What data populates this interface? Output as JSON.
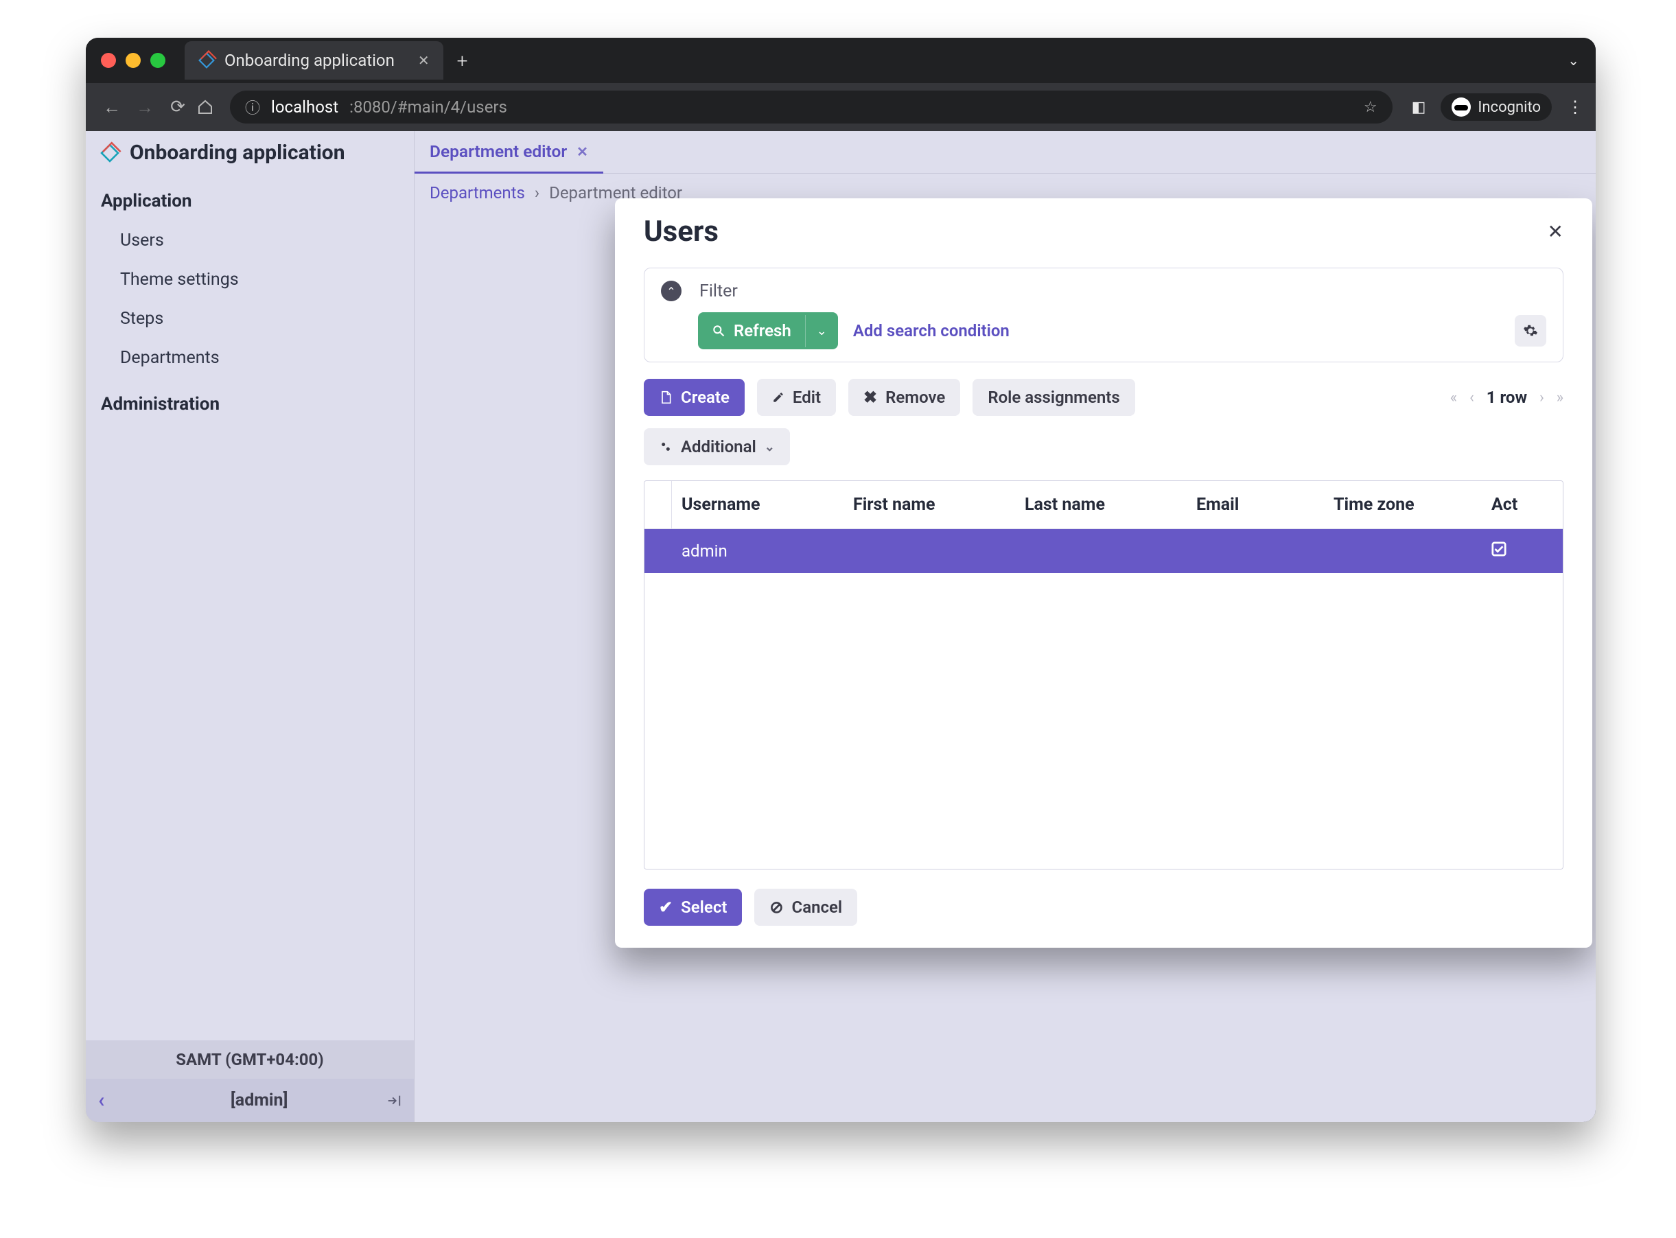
{
  "browser": {
    "tab_title": "Onboarding application",
    "url_host": "localhost",
    "url_port_path": ":8080/#main/4/users",
    "incognito_label": "Incognito"
  },
  "brand": {
    "title": "Onboarding application"
  },
  "sidebar": {
    "sections": [
      {
        "title": "Application",
        "items": [
          "Users",
          "Theme settings",
          "Steps",
          "Departments"
        ]
      },
      {
        "title": "Administration",
        "items": []
      }
    ],
    "timezone": "SAMT (GMT+04:00)",
    "user": "[admin]"
  },
  "tabs": [
    {
      "label": "Department editor"
    }
  ],
  "breadcrumbs": {
    "a": "Departments",
    "b": "Department editor"
  },
  "modal": {
    "title": "Users",
    "filter_label": "Filter",
    "refresh_label": "Refresh",
    "add_condition_label": "Add search condition",
    "toolbar": {
      "create": "Create",
      "edit": "Edit",
      "remove": "Remove",
      "roles": "Role assignments",
      "additional": "Additional"
    },
    "pager": {
      "count_label": "1 row"
    },
    "table": {
      "columns": [
        "Username",
        "First name",
        "Last name",
        "Email",
        "Time zone",
        "Act"
      ],
      "rows": [
        {
          "username": "admin",
          "first_name": "",
          "last_name": "",
          "email": "",
          "time_zone": "",
          "active": true
        }
      ]
    },
    "footer": {
      "select": "Select",
      "cancel": "Cancel"
    }
  }
}
